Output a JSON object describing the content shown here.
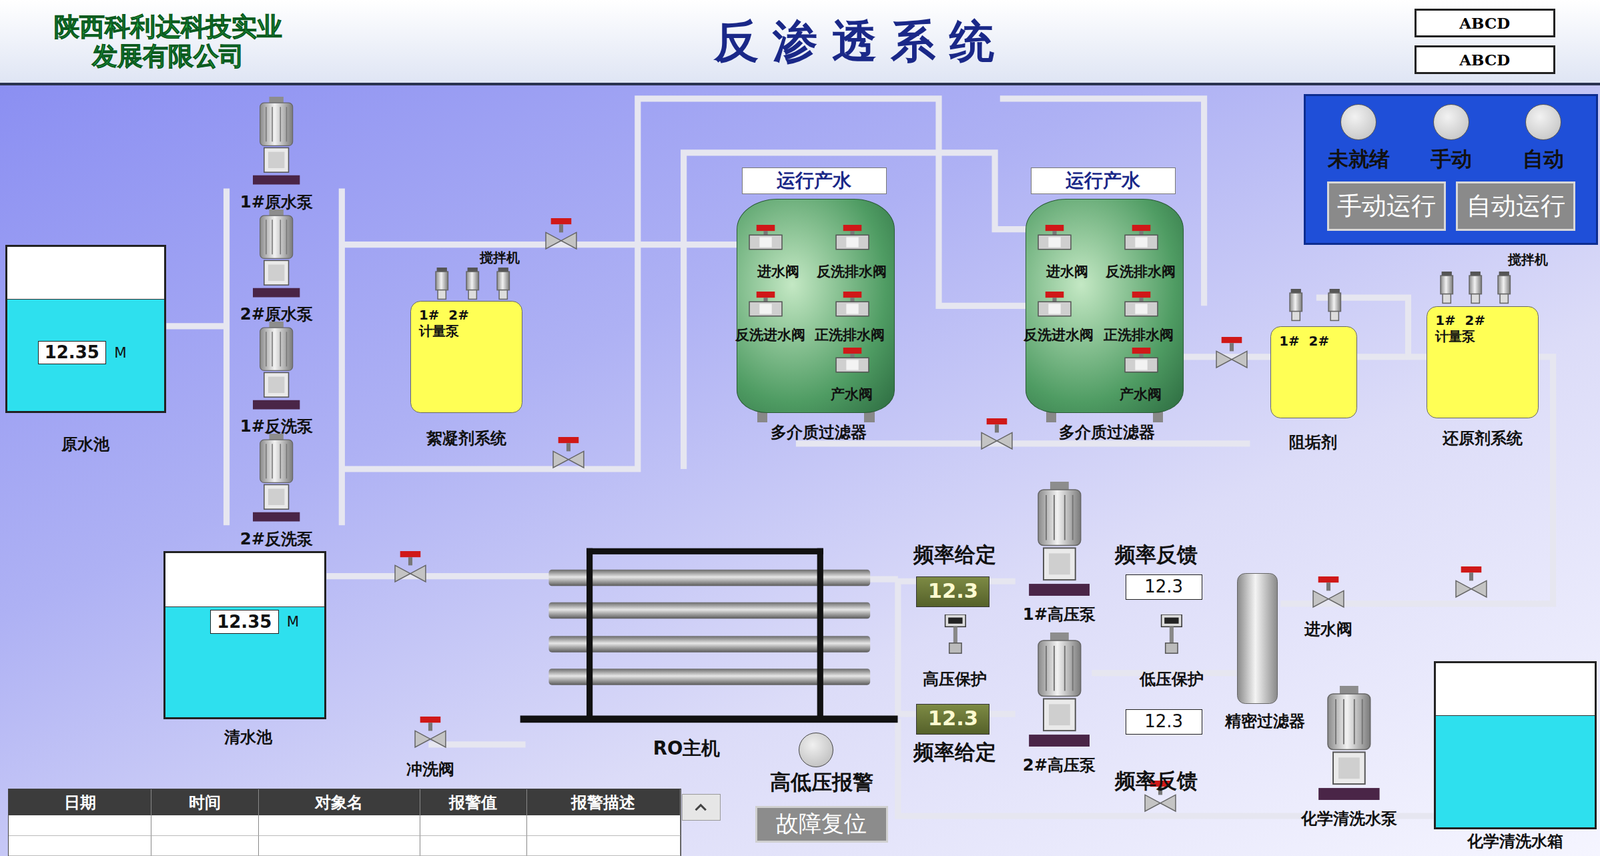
{
  "header": {
    "company": [
      "陕西科利达科技实业",
      "发展有限公司"
    ],
    "title": "反渗透系统",
    "tags": [
      "ABCD",
      "ABCD"
    ]
  },
  "mode_panel": {
    "lamps": [
      {
        "label": "未就绪",
        "on": false
      },
      {
        "label": "手动",
        "on": false
      },
      {
        "label": "自动",
        "on": false
      }
    ],
    "buttons": [
      "手动运行",
      "自动运行"
    ]
  },
  "raw_tank": {
    "label": "原水池",
    "level": 0.68,
    "reading": "12.35",
    "unit": "M"
  },
  "clear_tank": {
    "label": "清水池",
    "level": 0.67,
    "reading": "12.35",
    "unit": "M"
  },
  "chem_tank": {
    "label": "化学清洗水箱",
    "level": 0.68
  },
  "pumps": [
    "1#原水泵",
    "2#原水泵",
    "1#反洗泵",
    "2#反洗泵",
    "1#高压泵",
    "2#高压泵",
    "化学清洗水泵"
  ],
  "dosing": [
    {
      "label": "絮凝剂系统",
      "tag": [
        "1#  2#",
        "计量泵"
      ],
      "mixer": "搅拌机"
    },
    {
      "label": "阻垢剂",
      "tag": [
        "1#  2#"
      ],
      "mixer": ""
    },
    {
      "label": "还原剂系统",
      "tag": [
        "1#  2#",
        "计量泵"
      ],
      "mixer": "搅拌机"
    }
  ],
  "filters": [
    {
      "status": "运行产水",
      "label": "多介质过滤器",
      "valves": [
        "进水阀",
        "反洗排水阀",
        "反洗进水阀",
        "正洗排水阀",
        "产水阀"
      ]
    },
    {
      "status": "运行产水",
      "label": "多介质过滤器",
      "valves": [
        "进水阀",
        "反洗排水阀",
        "反洗进水阀",
        "正洗排水阀",
        "产水阀"
      ]
    }
  ],
  "ro": {
    "label": "RO主机",
    "alarm": {
      "label": "高低压报警",
      "on": false
    },
    "reset": "故障复位",
    "flush_valve": "冲洗阀"
  },
  "drives": [
    {
      "set_label": "频率给定",
      "set_value": "12.3",
      "feedback_label": "频率反馈",
      "feedback_value": "12.3"
    },
    {
      "set_label": "频率给定",
      "set_value": "12.3",
      "feedback_label": "频率反馈",
      "feedback_value": "12.3"
    }
  ],
  "protections": [
    "高压保护",
    "低压保护"
  ],
  "inlet_valve": "进水阀",
  "precision_filter": "精密过滤器",
  "alarm_table": {
    "columns": [
      "日期",
      "时间",
      "对象名",
      "报警值",
      "报警描述"
    ],
    "rows": []
  }
}
